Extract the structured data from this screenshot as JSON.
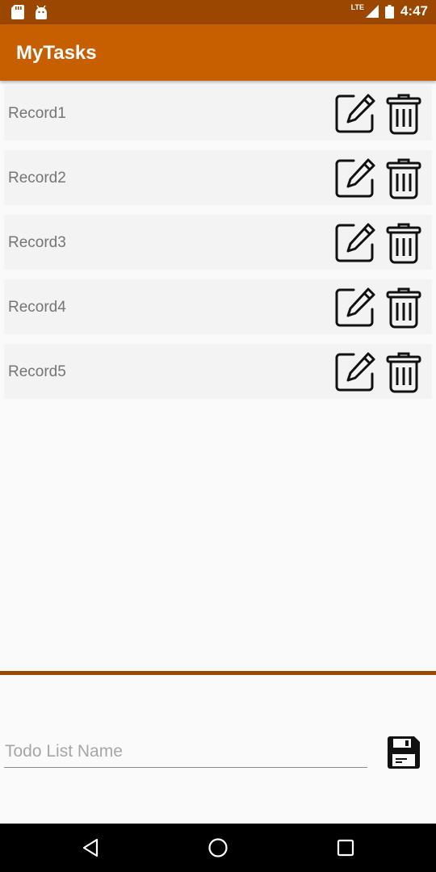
{
  "status_bar": {
    "time": "4:47",
    "network": "LTE",
    "icons": [
      "sd-card-icon",
      "android-icon",
      "signal-icon",
      "battery-icon"
    ]
  },
  "app_bar": {
    "title": "MyTasks"
  },
  "records": [
    {
      "label": "Record1"
    },
    {
      "label": "Record2"
    },
    {
      "label": "Record3"
    },
    {
      "label": "Record4"
    },
    {
      "label": "Record5"
    }
  ],
  "row_actions": [
    "edit-icon",
    "trash-icon"
  ],
  "input": {
    "placeholder": "Todo List Name",
    "value": ""
  },
  "save_icon": "floppy-disk-icon",
  "nav_icons": [
    "back-icon",
    "home-icon",
    "recents-icon"
  ],
  "colors": {
    "status_bar": "#9b4700",
    "app_bar": "#c75f00",
    "divider": "#9b4700",
    "background": "#fafafa",
    "row_background": "#f3f3f3"
  }
}
